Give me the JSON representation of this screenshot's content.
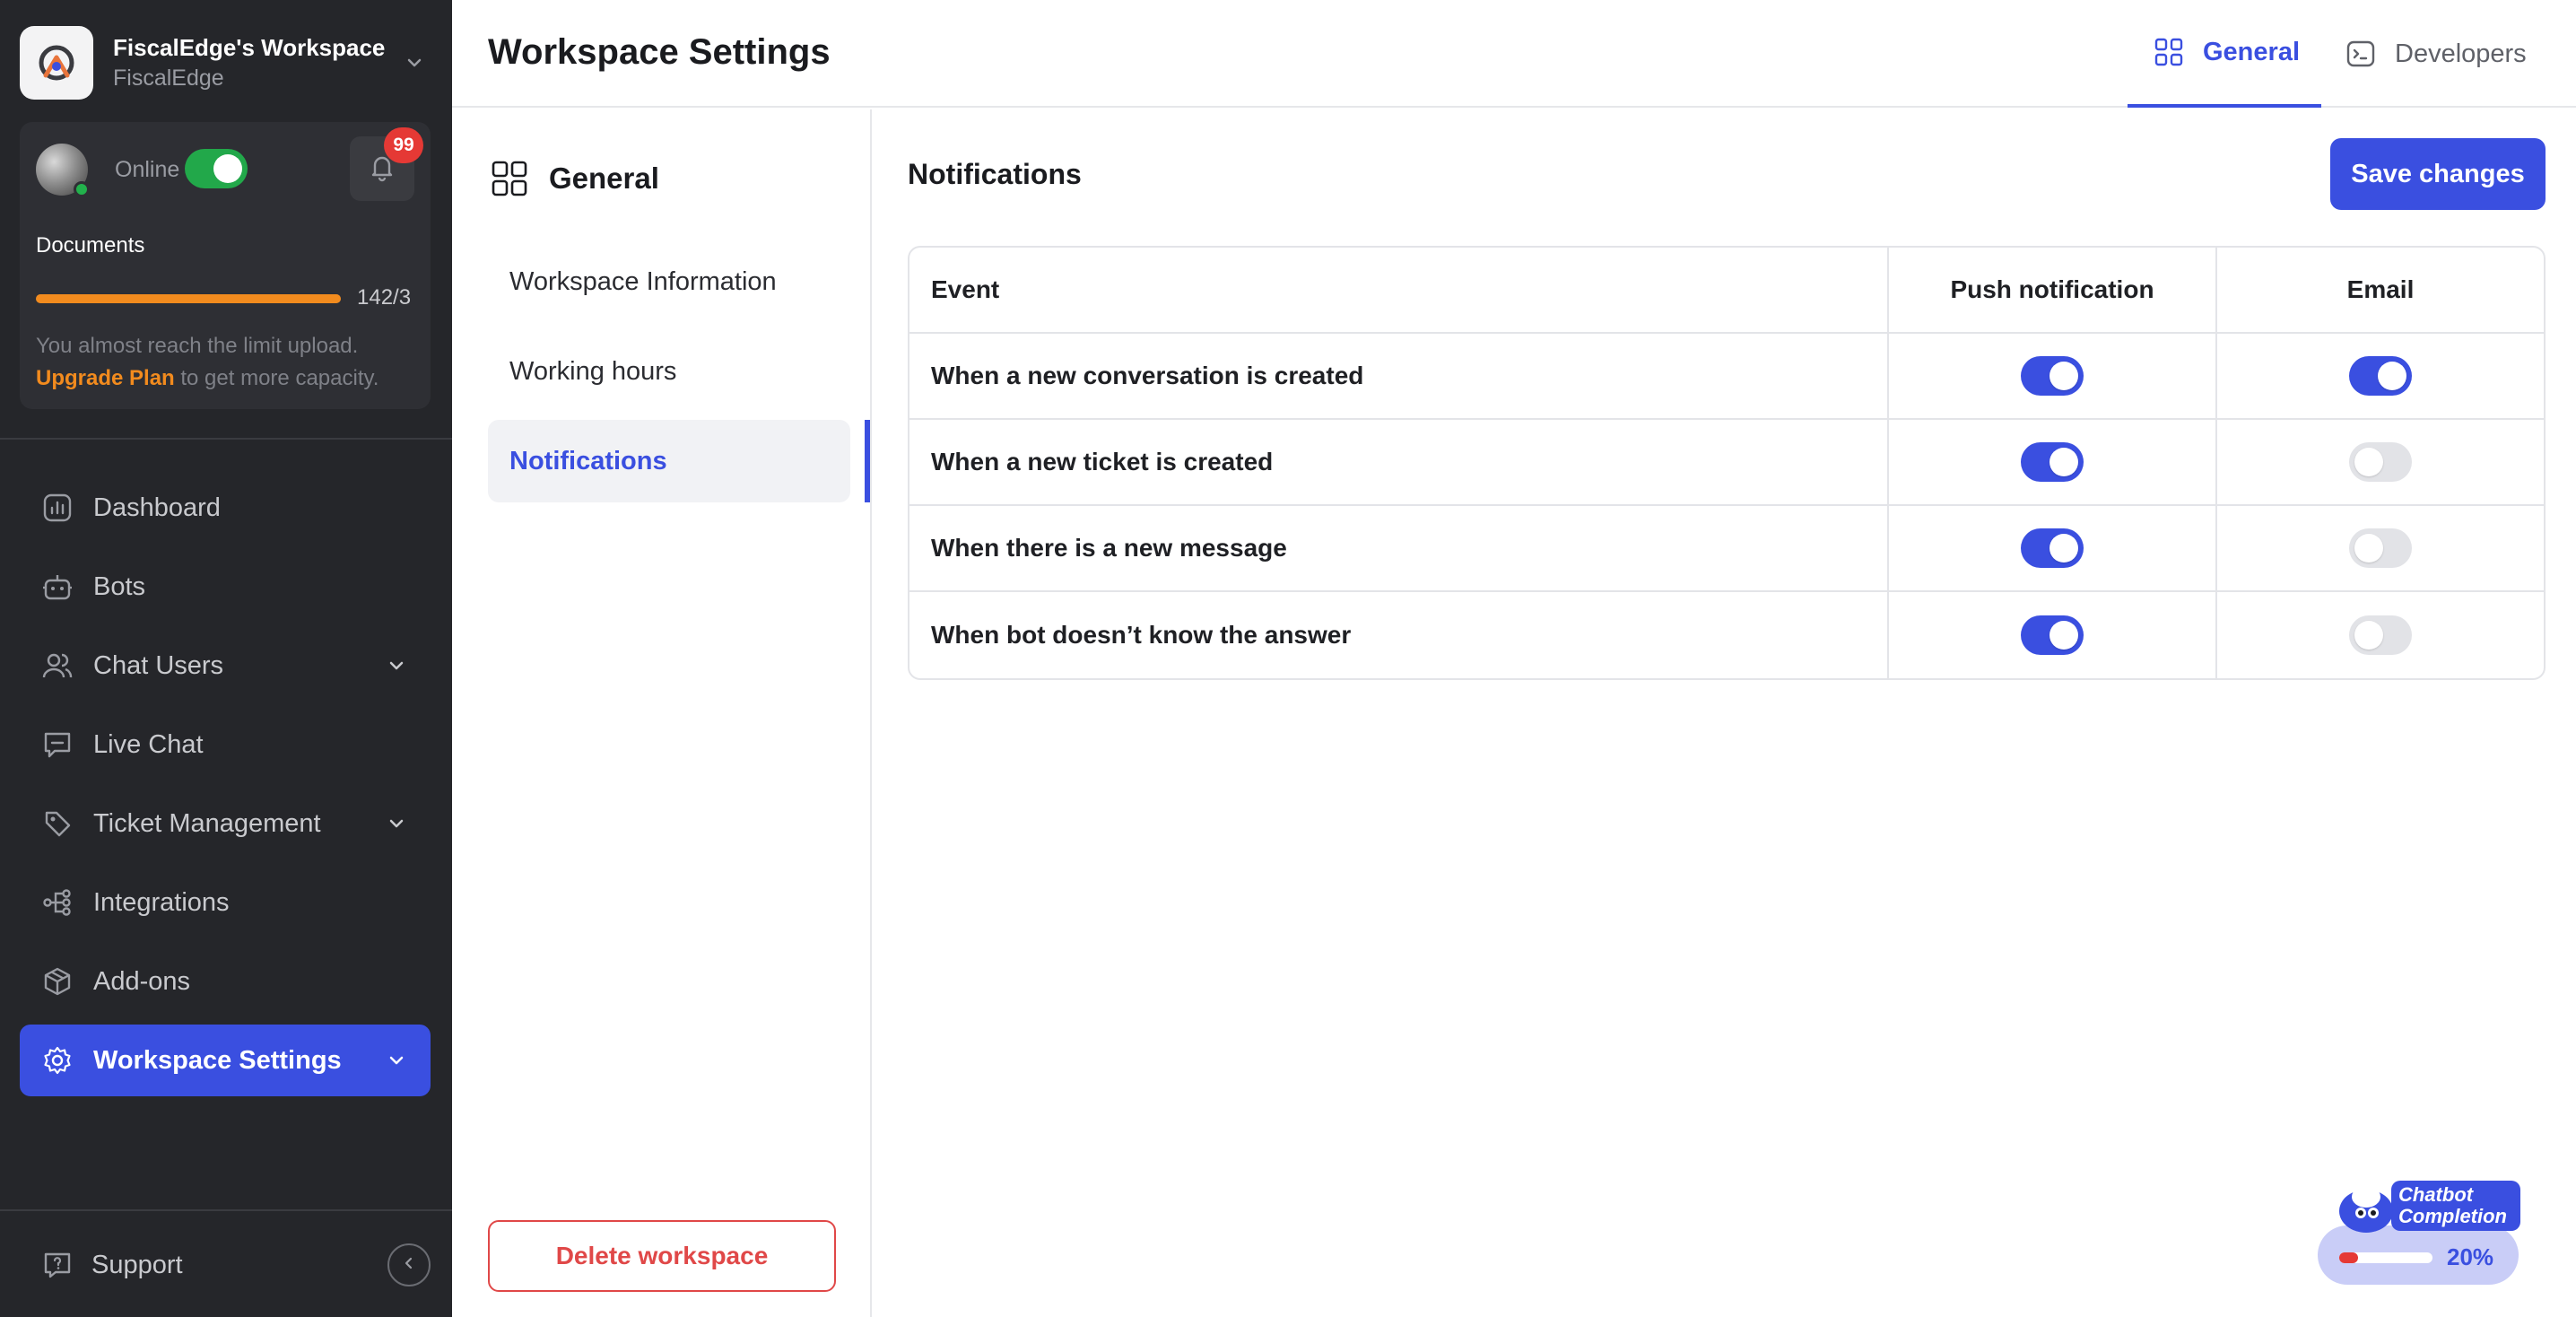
{
  "workspace": {
    "name": "FiscalEdge's Workspace",
    "org": "FiscalEdge"
  },
  "status": {
    "online_label": "Online",
    "online": true,
    "notification_count": "99",
    "documents_label": "Documents",
    "documents_count": "142/3",
    "documents_progress": 1.0,
    "limit_text": "You almost reach the limit upload.",
    "upgrade_label": "Upgrade Plan",
    "upgrade_suffix": "to get more capacity."
  },
  "nav": {
    "items": [
      {
        "label": "Dashboard",
        "icon": "dashboard-icon"
      },
      {
        "label": "Bots",
        "icon": "bot-icon"
      },
      {
        "label": "Chat Users",
        "icon": "users-icon",
        "expandable": true
      },
      {
        "label": "Live Chat",
        "icon": "chat-icon"
      },
      {
        "label": "Ticket Management",
        "icon": "tag-icon",
        "expandable": true
      },
      {
        "label": "Integrations",
        "icon": "integrations-icon"
      },
      {
        "label": "Add-ons",
        "icon": "package-icon"
      },
      {
        "label": "Workspace Settings",
        "icon": "gear-icon",
        "expandable": true,
        "active": true
      }
    ],
    "support_label": "Support"
  },
  "header": {
    "title": "Workspace Settings",
    "tabs": [
      {
        "label": "General",
        "active": true
      },
      {
        "label": "Developers",
        "active": false
      }
    ]
  },
  "subnav": {
    "heading": "General",
    "items": [
      {
        "label": "Workspace Information",
        "active": false
      },
      {
        "label": "Working hours",
        "active": false
      },
      {
        "label": "Notifications",
        "active": true
      }
    ],
    "delete_label": "Delete workspace"
  },
  "main": {
    "section_title": "Notifications",
    "save_label": "Save changes",
    "table": {
      "headers": [
        "Event",
        "Push notification",
        "Email"
      ],
      "rows": [
        {
          "event": "When a new conversation is created",
          "push": true,
          "email": true
        },
        {
          "event": "When a new ticket is created",
          "push": true,
          "email": false
        },
        {
          "event": "When there is a new message",
          "push": true,
          "email": false
        },
        {
          "event": "When bot doesn’t know the answer",
          "push": true,
          "email": false
        }
      ]
    }
  },
  "chatbot_widget": {
    "label_line1": "Chatbot",
    "label_line2": "Completion",
    "percent_label": "20%",
    "progress": 0.2
  },
  "colors": {
    "accent": "#3a4fe0",
    "sidebar_bg": "#25262a",
    "online_green": "#22a84a",
    "warning_orange": "#f28b1e",
    "danger_red": "#e04848"
  }
}
